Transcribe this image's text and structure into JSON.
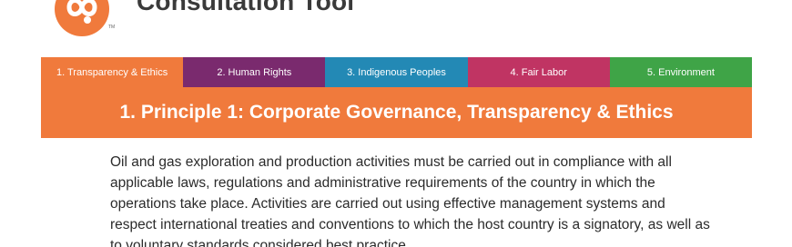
{
  "header": {
    "title": "Consultation Tool",
    "logo_icon": "infinity-swirl-logo",
    "trademark": "TM"
  },
  "tabs": [
    {
      "label": "1. Transparency & Ethics",
      "color": "#f07a3c"
    },
    {
      "label": "2. Human Rights",
      "color": "#7a2a6e"
    },
    {
      "label": "3. Indigenous Peoples",
      "color": "#2389b5"
    },
    {
      "label": "4. Fair Labor",
      "color": "#c03463"
    },
    {
      "label": "5. Environment",
      "color": "#3fa447"
    }
  ],
  "principle": {
    "title": "1. Principle 1: Corporate Governance, Transparency & Ethics",
    "body": "Oil and gas exploration and production activities must be carried out in compliance with all applicable laws, regulations and administrative requirements of the country in which the operations take place. Activities are carried out using effective management systems and respect international treaties and conventions to which the host country is a signatory, as well as to voluntary standards considered best practice."
  },
  "colors": {
    "accent": "#f07a3c",
    "text": "#2b2b2b"
  }
}
